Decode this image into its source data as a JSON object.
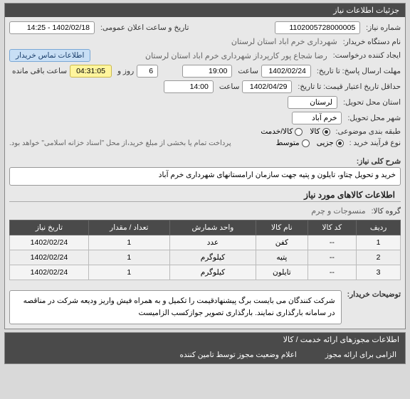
{
  "top_panel": {
    "title": "جزئیات اطلاعات نیاز",
    "need_number_label": "شماره نیاز:",
    "need_number": "1102005728000005",
    "announce_label": "تاریخ و ساعت اعلان عمومی:",
    "announce_value": "1402/02/18 - 14:25",
    "buyer_org_label": "نام دستگاه خریدار:",
    "buyer_org": "شهرداری خرم اباد استان لرستان",
    "creator_label": "ایجاد کننده درخواست:",
    "creator": "رضا شجاع پور کارپرداز شهرداری خرم اباد استان لرستان",
    "contact_btn": "اطلاعات تماس خریدار",
    "deadline_label": "مهلت ارسال پاسخ: تا تاریخ:",
    "deadline_date": "1402/02/24",
    "time_label": "ساعت",
    "deadline_time": "19:00",
    "day_label": "روز و",
    "days_left": "6",
    "countdown": "04:31:05",
    "remaining_label": "ساعت باقی مانده",
    "price_validity_label": "حداقل تاریخ اعتبار قیمت: تا تاریخ:",
    "price_validity_date": "1402/04/29",
    "price_validity_time": "14:00",
    "province_label": "استان محل تحویل:",
    "province": "لرستان",
    "city_label": "شهر محل تحویل:",
    "city": "خرم آباد",
    "subject_class_label": "طبقه بندی موضوعی:",
    "subject_kala": "کالا",
    "subject_service": "کالا/خدمت",
    "process_label": "نوع فرآیند خرید :",
    "process_partial": "جزیی",
    "process_med": "متوسط",
    "payment_note": "پرداخت تمام یا بخشی از مبلغ خرید،از محل \"اسناد خزانه اسلامی\" خواهد بود.",
    "desc_label": "شرح کلی نیاز:",
    "desc_value": "خرید و تحویل چتاو، تایلون و پتیه جهت سازمان ارامستانهای شهرداری خرم آباد"
  },
  "goods_panel": {
    "title": "اطلاعات کالاهای مورد نیاز",
    "group_label": "گروه کالا:",
    "group_value": "منسوجات و چرم",
    "table": {
      "headers": [
        "ردیف",
        "کد کالا",
        "نام کالا",
        "واحد شمارش",
        "تعداد / مقدار",
        "تاریخ نیاز"
      ],
      "rows": [
        [
          "1",
          "--",
          "کفن",
          "عدد",
          "1",
          "1402/02/24"
        ],
        [
          "2",
          "--",
          "پتیه",
          "کیلوگرم",
          "1",
          "1402/02/24"
        ],
        [
          "3",
          "--",
          "تایلون",
          "کیلوگرم",
          "1",
          "1402/02/24"
        ]
      ]
    },
    "buyer_notes_label": "توضیحات خریدار:",
    "buyer_notes": "شرکت کنندگان می بایست برگ پیشنهادقیمت را تکمیل و به همراه فیش واریز ودیعه شرکت در مناقصه در سامانه بارگذاری نمایند. بارگذاری تصویر جوازکسب الزامیست"
  },
  "services_panel": {
    "title": "اطلاعات مجوزهای ارائه خدمت / کالا",
    "tabs": [
      "الزامی برای ارائه مجوز",
      "اعلام وضعیت مجوز توسط تامین کننده"
    ]
  }
}
